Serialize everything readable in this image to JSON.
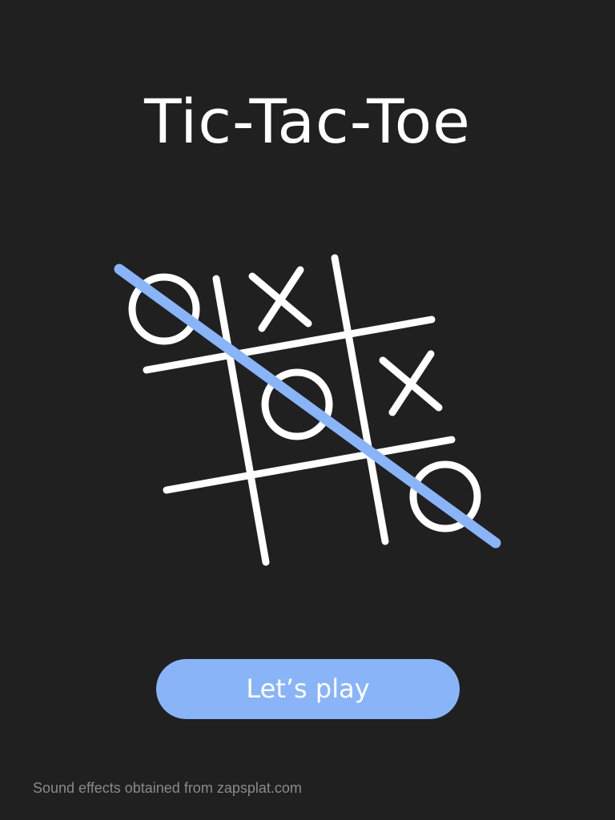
{
  "title": "Tic-Tac-Toe",
  "play_button_label": "Let’s play",
  "footer_text": "Sound effects obtained from zapsplat.com",
  "colors": {
    "background": "#202020",
    "chalk": "#ffffff",
    "accent": "#8ab4f8",
    "footer_text": "#8a8a8a"
  },
  "board": {
    "cells": [
      [
        "O",
        "X",
        ""
      ],
      [
        "",
        "O",
        "X"
      ],
      [
        "",
        "",
        "O"
      ]
    ],
    "winning_line": "main-diagonal"
  }
}
